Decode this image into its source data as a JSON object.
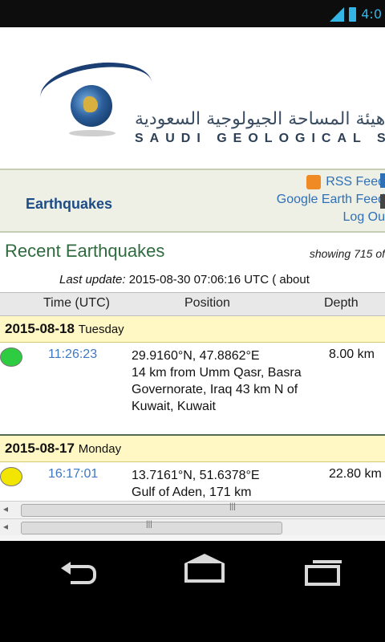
{
  "status_bar": {
    "time": "4:0"
  },
  "header": {
    "org_name_ar": "هيئة المساحة الجيولوجية السعودية",
    "org_name_en": "SAUDI GEOLOGICAL SURV"
  },
  "nav": {
    "title": "Earthquakes",
    "rss_label": "RSS Feed",
    "google_label": "Google Earth Feed",
    "log_label": "Log Ou"
  },
  "summary": {
    "title": "Recent Earthquakes",
    "showing": "showing 715 of",
    "last_update_label": "Last update:",
    "last_update_value": "2015-08-30 07:06:16 UTC ( about"
  },
  "table": {
    "columns": [
      "Time (UTC)",
      "Position",
      "Depth"
    ],
    "days": [
      {
        "date": "2015-08-18",
        "weekday": "Tuesday",
        "events": [
          {
            "dot_color": "#2ecc40",
            "time": "11:26:23",
            "coords": "29.9160°N, 47.8862°E",
            "location": "14 km from Umm Qasr, Basra Governorate, Iraq 43 km N of Kuwait, Kuwait",
            "depth": "8.00 km"
          }
        ]
      },
      {
        "date": "2015-08-17",
        "weekday": "Monday",
        "events": [
          {
            "dot_color": "#f2e600",
            "time": "16:17:01",
            "coords": "13.7161°N, 51.6378°E",
            "location": "Gulf of Aden, 171 km",
            "depth": "22.80 km"
          }
        ]
      }
    ]
  },
  "colors": {
    "accent_blue": "#33b5e5",
    "nav_title": "#1e4c86",
    "recent_title": "#2f6b3e",
    "day_row_bg": "#fff8c4"
  }
}
